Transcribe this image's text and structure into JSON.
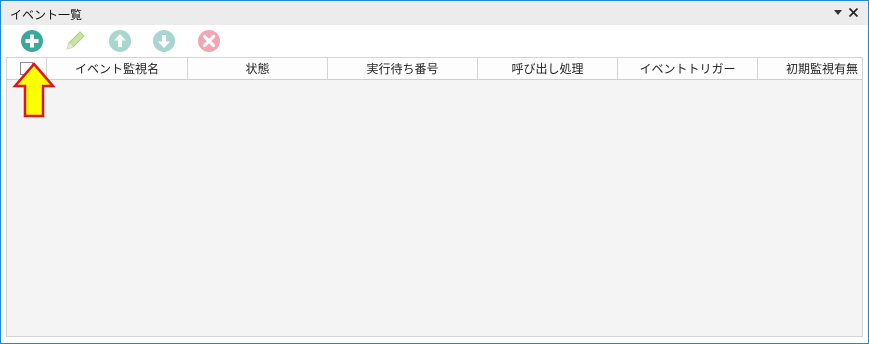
{
  "panel": {
    "title": "イベント一覧",
    "pin_icon": "dropdown-triangle-icon",
    "close_icon": "close-icon"
  },
  "toolbar": {
    "buttons": [
      {
        "name": "add",
        "icon": "plus-circle-icon",
        "color": "#3aa89b",
        "enabled": true
      },
      {
        "name": "edit",
        "icon": "pencil-icon",
        "color": "#b9dc96",
        "enabled": false
      },
      {
        "name": "move-up",
        "icon": "arrow-up-circle-icon",
        "color": "#a8d6cf",
        "enabled": false
      },
      {
        "name": "move-down",
        "icon": "arrow-down-circle-icon",
        "color": "#a8d6cf",
        "enabled": false
      },
      {
        "name": "delete",
        "icon": "x-circle-icon",
        "color": "#f0a6b4",
        "enabled": false
      }
    ]
  },
  "grid": {
    "columns": [
      "イベント監視名",
      "状態",
      "実行待ち番号",
      "呼び出し処理",
      "イベントトリガー",
      "初期監視有無"
    ],
    "rows": []
  },
  "annotation": {
    "icon": "up-arrow-highlight-icon",
    "fill": "#ffff00",
    "stroke": "#e0141e"
  }
}
